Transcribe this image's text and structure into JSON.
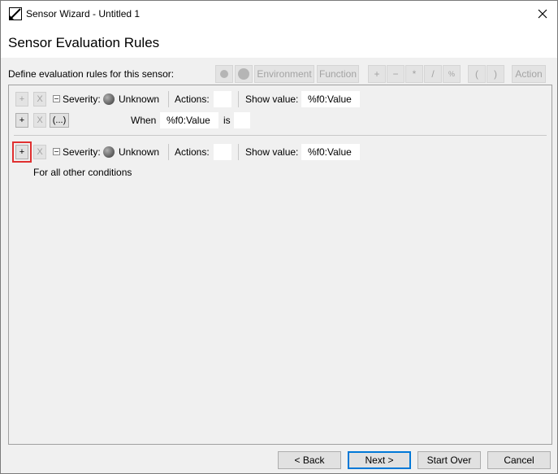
{
  "window": {
    "title": "Sensor Wizard - Untitled 1"
  },
  "page": {
    "heading": "Sensor Evaluation Rules",
    "define_label": "Define evaluation rules for this sensor:"
  },
  "toolbar": {
    "environment": "Environment",
    "function": "Function",
    "plus": "+",
    "minus": "−",
    "multiply": "*",
    "divide": "/",
    "percent": "%",
    "lparen": "(",
    "rparen": ")",
    "action": "Action"
  },
  "rule1": {
    "add": "+",
    "remove": "X",
    "severity_label": "Severity:",
    "severity_value": "Unknown",
    "actions_label": "Actions:",
    "actions_value": "",
    "show_value_label": "Show value:",
    "show_value": "%f0:Value",
    "condition": {
      "add": "+",
      "remove": "X",
      "group": "(...)",
      "when_label": "When",
      "when_value": "%f0:Value",
      "is_label": "is",
      "is_value": ""
    }
  },
  "rule2": {
    "add": "+",
    "remove": "X",
    "severity_label": "Severity:",
    "severity_value": "Unknown",
    "actions_label": "Actions:",
    "actions_value": "",
    "show_value_label": "Show value:",
    "show_value": "%f0:Value",
    "other_text": "For all other conditions"
  },
  "buttons": {
    "back": "< Back",
    "next": "Next >",
    "start_over": "Start Over",
    "cancel": "Cancel"
  },
  "colors": {
    "window_bg": "#f0f0f0",
    "focus_outline": "#e03030",
    "default_button_border": "#0078d7",
    "disabled_text": "#a3a3a3"
  }
}
